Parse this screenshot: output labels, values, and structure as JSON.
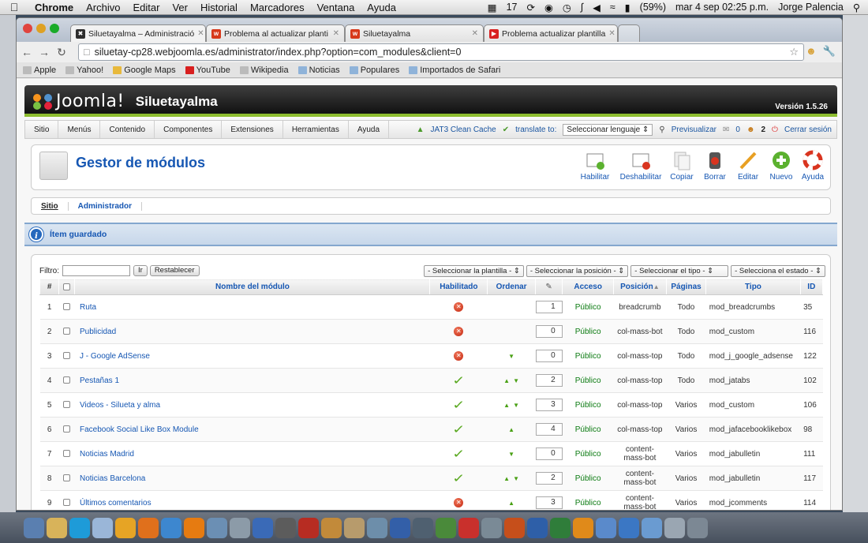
{
  "menubar": {
    "app": "Chrome",
    "items": [
      "Archivo",
      "Editar",
      "Ver",
      "Historial",
      "Marcadores",
      "Ventana",
      "Ayuda"
    ],
    "status": {
      "badge": "17",
      "battery": "(59%)",
      "clock": "mar 4 sep  02:25 p.m.",
      "user": "Jorge Palencia"
    }
  },
  "tabs": [
    {
      "title": "Siluetayalma – Administració",
      "color": "#333"
    },
    {
      "title": "Problema al actualizar planti",
      "color": "#d7381a"
    },
    {
      "title": "Siluetayalma",
      "color": "#d7381a"
    },
    {
      "title": "Problema actualizar plantilla",
      "color": "#d81f1f"
    }
  ],
  "url": "siluetay-cp28.webjoomla.es/administrator/index.php?option=com_modules&client=0",
  "bookmarks": [
    "Apple",
    "Yahoo!",
    "Google Maps",
    "YouTube",
    "Wikipedia",
    "Noticias",
    "Populares",
    "Importados de Safari"
  ],
  "joomla": {
    "brand": "Joomla!",
    "site": "Siluetayalma",
    "version": "Versión 1.5.26",
    "menu": [
      "Sitio",
      "Menús",
      "Contenido",
      "Componentes",
      "Extensiones",
      "Herramientas",
      "Ayuda"
    ],
    "menu_right": {
      "cache": "JAT3 Clean Cache",
      "translate": "translate to:",
      "lang": "Seleccionar lenguaje",
      "preview": "Previsualizar",
      "msgs": "0",
      "users": "2",
      "logout": "Cerrar sesión"
    },
    "page_title": "Gestor de módulos",
    "toolbar": [
      "Habilitar",
      "Deshabilitar",
      "Copiar",
      "Borrar",
      "Editar",
      "Nuevo",
      "Ayuda"
    ],
    "subnav": [
      "Sitio",
      "Administrador"
    ],
    "message": "Ítem guardado",
    "filter": {
      "label": "Filtro:",
      "go": "Ir",
      "reset": "Restablecer"
    },
    "selects": [
      "- Seleccionar la plantilla -",
      "- Seleccionar la posición -",
      "- Seleccionar el tipo -",
      "- Selecciona el estado -"
    ],
    "columns": [
      "#",
      "",
      "Nombre del módulo",
      "Habilitado",
      "Ordenar",
      "",
      "Acceso",
      "Posición",
      "Páginas",
      "Tipo",
      "ID"
    ],
    "rows": [
      {
        "n": "1",
        "name": "Ruta",
        "enabled": false,
        "up": false,
        "down": false,
        "order": "1",
        "access": "Público",
        "pos": "breadcrumb",
        "pages": "Todo",
        "type": "mod_breadcrumbs",
        "id": "35"
      },
      {
        "n": "2",
        "name": "Publicidad",
        "enabled": false,
        "up": false,
        "down": false,
        "order": "0",
        "access": "Público",
        "pos": "col-mass-bot",
        "pages": "Todo",
        "type": "mod_custom",
        "id": "116"
      },
      {
        "n": "3",
        "name": "J - Google AdSense",
        "enabled": false,
        "up": false,
        "down": true,
        "order": "0",
        "access": "Público",
        "pos": "col-mass-top",
        "pages": "Todo",
        "type": "mod_j_google_adsense",
        "id": "122"
      },
      {
        "n": "4",
        "name": "Pestañas 1",
        "enabled": true,
        "up": true,
        "down": true,
        "order": "2",
        "access": "Público",
        "pos": "col-mass-top",
        "pages": "Todo",
        "type": "mod_jatabs",
        "id": "102"
      },
      {
        "n": "5",
        "name": "Videos - Silueta y alma",
        "enabled": true,
        "up": true,
        "down": true,
        "order": "3",
        "access": "Público",
        "pos": "col-mass-top",
        "pages": "Varios",
        "type": "mod_custom",
        "id": "106"
      },
      {
        "n": "6",
        "name": "Facebook Social Like Box Module",
        "enabled": true,
        "up": true,
        "down": false,
        "order": "4",
        "access": "Público",
        "pos": "col-mass-top",
        "pages": "Varios",
        "type": "mod_jafacebooklikebox",
        "id": "98"
      },
      {
        "n": "7",
        "name": "Noticias Madrid",
        "enabled": true,
        "up": false,
        "down": true,
        "order": "0",
        "access": "Público",
        "pos": "content-mass-bot",
        "pages": "Varios",
        "type": "mod_jabulletin",
        "id": "111"
      },
      {
        "n": "8",
        "name": "Noticias Barcelona",
        "enabled": true,
        "up": true,
        "down": true,
        "order": "2",
        "access": "Público",
        "pos": "content-mass-bot",
        "pages": "Varios",
        "type": "mod_jabulletin",
        "id": "117"
      },
      {
        "n": "9",
        "name": "Últimos comentarios",
        "enabled": false,
        "up": true,
        "down": false,
        "order": "3",
        "access": "Público",
        "pos": "content-mass-bot",
        "pages": "Varios",
        "type": "mod_jcomments",
        "id": "114"
      }
    ]
  }
}
